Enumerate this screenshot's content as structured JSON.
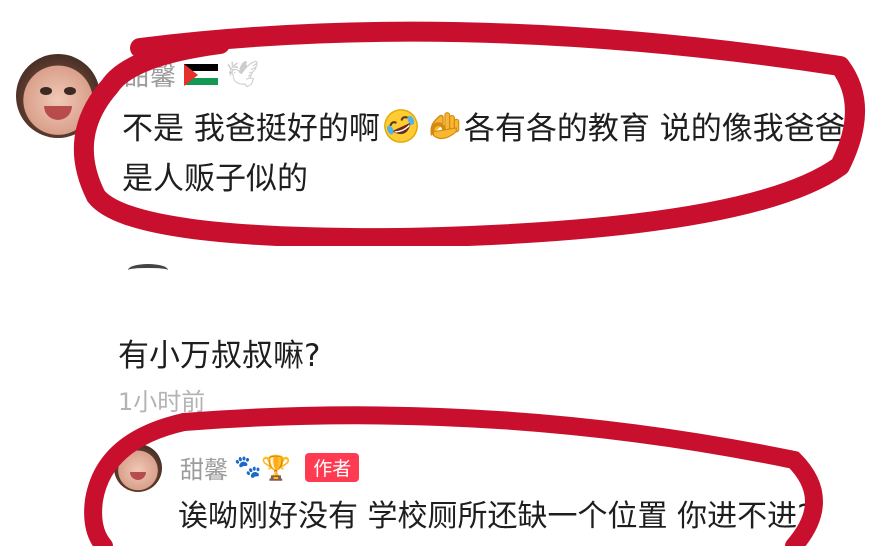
{
  "comment_top": {
    "username": "甜馨",
    "flag_icon": "palestine-flag-icon",
    "dove_icon": "dove-icon",
    "text_part1": "不是 我爸挺好的啊",
    "emoji1": "rolling-laughing-emoji",
    "emoji2": "ok-hand-emoji",
    "text_part2": "各有各的教育 说的像我爸爸是人贩子似的"
  },
  "comment_mid": {
    "text": "有小万叔叔嘛?",
    "timestamp": "1小时前"
  },
  "reply": {
    "username": "甜馨",
    "paw_icon": "paw-prints-icon",
    "trophy_icon": "trophy-icon",
    "badge": "作者",
    "text": "诶呦刚好没有 学校厕所还缺一个位置 你进不进?"
  },
  "colors": {
    "marker_red": "#c8102e",
    "badge_red": "#ff3b52",
    "username_gray": "#9c9c9c"
  }
}
